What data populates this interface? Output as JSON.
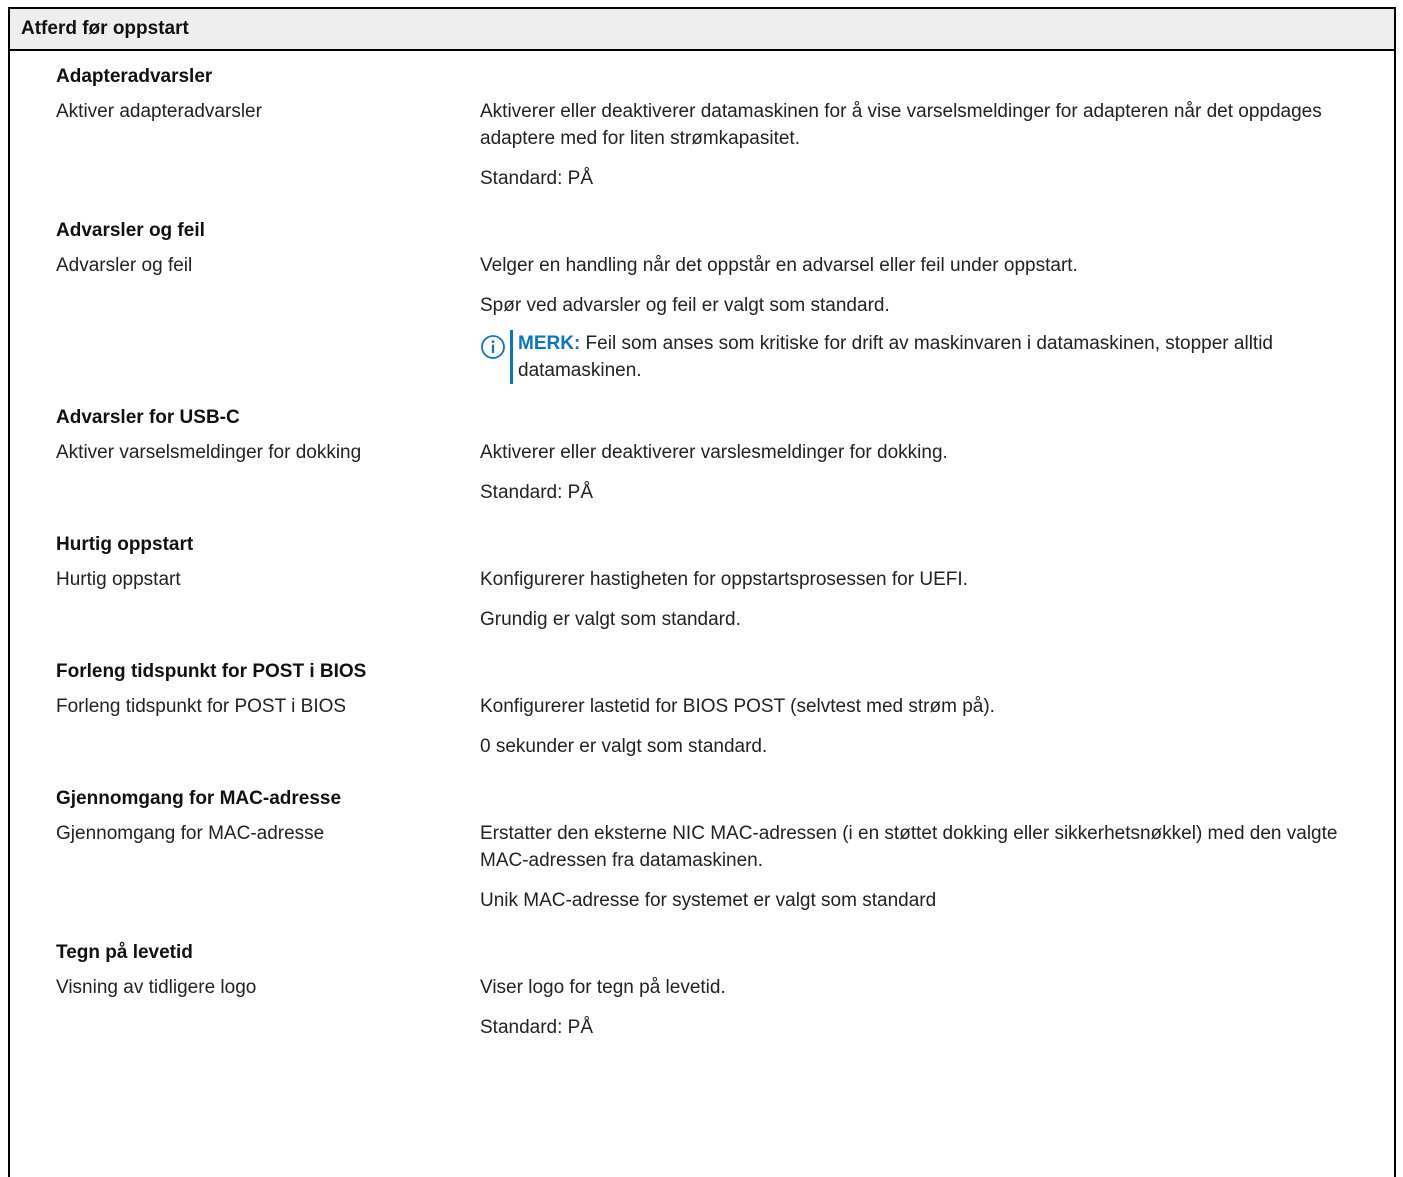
{
  "table": {
    "title": "Atferd før oppstart"
  },
  "sections": [
    {
      "title": "Adapteradvarsler",
      "option": "Aktiver adapteradvarsler",
      "desc": [
        "Aktiverer eller deaktiverer datamaskinen for å vise varselsmeldinger for adapteren når det oppdages adaptere med for liten strømkapasitet.",
        "Standard: PÅ"
      ]
    },
    {
      "title": "Advarsler og feil",
      "option": "Advarsler og feil",
      "desc": [
        "Velger en handling når det oppstår en advarsel eller feil under oppstart.",
        "Spør ved advarsler og feil er valgt som standard."
      ],
      "note_label": "MERK:",
      "note_text": " Feil som anses som kritiske for drift av maskinvaren i datamaskinen, stopper alltid datamaskinen."
    },
    {
      "title": "Advarsler for USB-C",
      "option": "Aktiver varselsmeldinger for dokking",
      "desc": [
        "Aktiverer eller deaktiverer varslesmeldinger for dokking.",
        "Standard: PÅ"
      ]
    },
    {
      "title": "Hurtig oppstart",
      "option": "Hurtig oppstart",
      "desc": [
        "Konfigurerer hastigheten for oppstartsprosessen for UEFI.",
        "Grundig er valgt som standard."
      ]
    },
    {
      "title": "Forleng tidspunkt for POST i BIOS",
      "option": "Forleng tidspunkt for POST i BIOS",
      "desc": [
        "Konfigurerer lastetid for BIOS POST (selvtest med strøm på).",
        "0 sekunder er valgt som standard."
      ]
    },
    {
      "title": "Gjennomgang for MAC-adresse",
      "option": "Gjennomgang for MAC-adresse",
      "desc": [
        "Erstatter den eksterne NIC MAC-adressen (i en støttet dokking eller sikkerhetsnøkkel) med den valgte MAC-adressen fra datamaskinen.",
        "Unik MAC-adresse for systemet er valgt som standard"
      ]
    },
    {
      "title": "Tegn på levetid",
      "option": "Visning av tidligere logo",
      "desc": [
        "Viser logo for tegn på levetid.",
        "Standard: PÅ"
      ]
    }
  ],
  "colors": {
    "note_accent": "#0b76bd",
    "header_bg": "#eeeeee"
  },
  "icons": {
    "note": "info-icon"
  }
}
